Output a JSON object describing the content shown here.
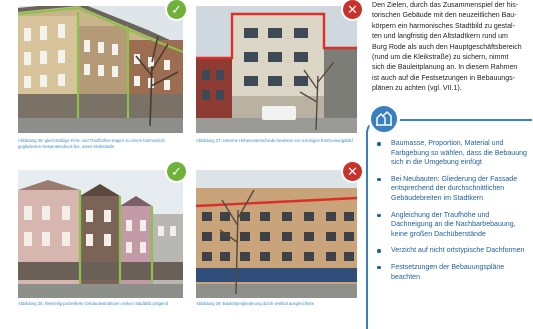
{
  "captions": {
    "fig36": "Abbildung 36: gleichmäßige First- und Traufhöhen tragen zu einem harmonisch gegliederten Gesamteindruck bei, unten Kleikstraße",
    "fig37": "Abbildung 37: extreme Höhenunterschiede bewirken ein unruhiges Erscheinungsbild",
    "fig38": "Abbildung 38: kleinteilig parzellierte Gebäudestrukturen wirken Stadtbild prägend",
    "fig39": "Abbildung 39: Baukörpergliederung durch vertikal ausgerichtete"
  },
  "badges": {
    "fig36": "✓",
    "fig37": "✕",
    "fig38": "✓",
    "fig39": "✕"
  },
  "intro_lines": [
    "Den Zielen, durch das Zusammenspiel der his-",
    "torischen Gebäude mit den neuzeitlichen Bau-",
    "körpern ein harmonisches Stadtbild zu gestal-",
    "ten und langfristig den Altstadtkern rund um",
    "Burg Rode als auch den Hauptgeschäftsbereich",
    "(rund um die Kleikstraße) zu sichern, nimmt",
    "sich die Bauleitplanung an. In diesem Rahmen",
    "ist auch auf die Festsetzungen in Bebauungs-",
    "plänen zu achten (vgl. VII.1)."
  ],
  "guidelines": [
    "Baumasse, Proportion, Material und Farbgebung so wählen, dass die Bebauung sich in die Umgebung einfügt",
    "Bei Neubauten: Gliederung der Fassade entsprechend der durchschnittlichen Gebäudebreiten im Stadtkern",
    "Angleichung der Traufhöhe und Dachneigung an die Nachbarbebauung, keine großen Dachüberstände",
    "Verzicht auf nicht ortstypische Dachformen",
    "Festsetzungen der Bebauungspläne beachten"
  ],
  "panel_icon": "house-icon",
  "colors": {
    "accent_blue": "#3a7fc0",
    "text_blue": "#1e5f9e",
    "ok_green": "#6fb23a",
    "no_red": "#c8322d"
  }
}
